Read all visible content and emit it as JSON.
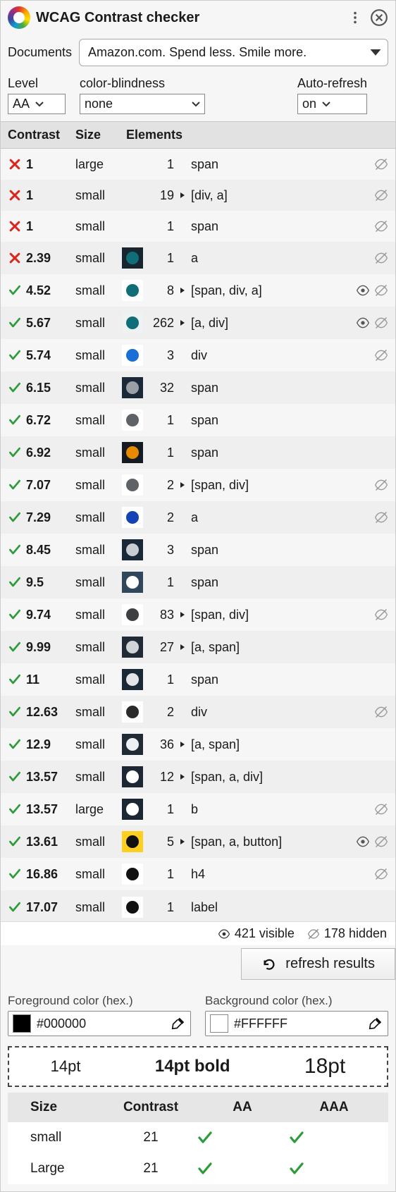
{
  "header": {
    "title": "WCAG Contrast checker"
  },
  "documents": {
    "label": "Documents",
    "selected": "Amazon.com. Spend less. Smile more."
  },
  "level": {
    "label": "Level",
    "value": "AA"
  },
  "cb": {
    "label": "color-blindness",
    "value": "none"
  },
  "autorefresh": {
    "label": "Auto-refresh",
    "value": "on"
  },
  "table": {
    "headers": {
      "contrast": "Contrast",
      "size": "Size",
      "elements": "Elements"
    },
    "rows": [
      {
        "pass": false,
        "contrast": "1",
        "size": "large",
        "swatch_bg": null,
        "swatch_fg": null,
        "count": 1,
        "expandable": false,
        "elements": "span",
        "eye": false,
        "hide": true
      },
      {
        "pass": false,
        "contrast": "1",
        "size": "small",
        "swatch_bg": null,
        "swatch_fg": null,
        "count": 19,
        "expandable": true,
        "elements": "[div, a]",
        "eye": false,
        "hide": true
      },
      {
        "pass": false,
        "contrast": "1",
        "size": "small",
        "swatch_bg": null,
        "swatch_fg": null,
        "count": 1,
        "expandable": false,
        "elements": "span",
        "eye": false,
        "hide": true
      },
      {
        "pass": false,
        "contrast": "2.39",
        "size": "small",
        "swatch_bg": "#16252f",
        "swatch_fg": "#0f6e78",
        "count": 1,
        "expandable": false,
        "elements": "a",
        "eye": false,
        "hide": true
      },
      {
        "pass": true,
        "contrast": "4.52",
        "size": "small",
        "swatch_bg": "#ffffff",
        "swatch_fg": "#0f6e78",
        "count": 8,
        "expandable": true,
        "elements": "[span, div, a]",
        "eye": true,
        "hide": true
      },
      {
        "pass": true,
        "contrast": "5.67",
        "size": "small",
        "swatch_bg": "#eef2f2",
        "swatch_fg": "#0f6e78",
        "count": 262,
        "expandable": true,
        "elements": "[a, div]",
        "eye": true,
        "hide": true
      },
      {
        "pass": true,
        "contrast": "5.74",
        "size": "small",
        "swatch_bg": "#ffffff",
        "swatch_fg": "#1a6fd6",
        "count": 3,
        "expandable": false,
        "elements": "div",
        "eye": false,
        "hide": true
      },
      {
        "pass": true,
        "contrast": "6.15",
        "size": "small",
        "swatch_bg": "#1b2838",
        "swatch_fg": "#9aa0a6",
        "count": 32,
        "expandable": false,
        "elements": "span",
        "eye": false,
        "hide": false
      },
      {
        "pass": true,
        "contrast": "6.72",
        "size": "small",
        "swatch_bg": "#ffffff",
        "swatch_fg": "#5f6368",
        "count": 1,
        "expandable": false,
        "elements": "span",
        "eye": false,
        "hide": false
      },
      {
        "pass": true,
        "contrast": "6.92",
        "size": "small",
        "swatch_bg": "#131a22",
        "swatch_fg": "#e68a00",
        "count": 1,
        "expandable": false,
        "elements": "span",
        "eye": false,
        "hide": false
      },
      {
        "pass": true,
        "contrast": "7.07",
        "size": "small",
        "swatch_bg": "#ffffff",
        "swatch_fg": "#5f6368",
        "count": 2,
        "expandable": true,
        "elements": "[span, div]",
        "eye": false,
        "hide": true
      },
      {
        "pass": true,
        "contrast": "7.29",
        "size": "small",
        "swatch_bg": "#ffffff",
        "swatch_fg": "#1444b3",
        "count": 2,
        "expandable": false,
        "elements": "a",
        "eye": false,
        "hide": true
      },
      {
        "pass": true,
        "contrast": "8.45",
        "size": "small",
        "swatch_bg": "#1b2838",
        "swatch_fg": "#c8cdd2",
        "count": 3,
        "expandable": false,
        "elements": "span",
        "eye": false,
        "hide": false
      },
      {
        "pass": true,
        "contrast": "9.5",
        "size": "small",
        "swatch_bg": "#30465a",
        "swatch_fg": "#ffffff",
        "count": 1,
        "expandable": false,
        "elements": "span",
        "eye": false,
        "hide": false
      },
      {
        "pass": true,
        "contrast": "9.74",
        "size": "small",
        "swatch_bg": "#ffffff",
        "swatch_fg": "#3e3f41",
        "count": 83,
        "expandable": true,
        "elements": "[span, div]",
        "eye": false,
        "hide": true
      },
      {
        "pass": true,
        "contrast": "9.99",
        "size": "small",
        "swatch_bg": "#212b36",
        "swatch_fg": "#d0d4d8",
        "count": 27,
        "expandable": true,
        "elements": "[a, span]",
        "eye": false,
        "hide": false
      },
      {
        "pass": true,
        "contrast": "11",
        "size": "small",
        "swatch_bg": "#1b2838",
        "swatch_fg": "#e2e5e8",
        "count": 1,
        "expandable": false,
        "elements": "span",
        "eye": false,
        "hide": false
      },
      {
        "pass": true,
        "contrast": "12.63",
        "size": "small",
        "swatch_bg": "#ffffff",
        "swatch_fg": "#2a2a2a",
        "count": 2,
        "expandable": false,
        "elements": "div",
        "eye": false,
        "hide": true
      },
      {
        "pass": true,
        "contrast": "12.9",
        "size": "small",
        "swatch_bg": "#212b36",
        "swatch_fg": "#eef1f3",
        "count": 36,
        "expandable": true,
        "elements": "[a, span]",
        "eye": false,
        "hide": false
      },
      {
        "pass": true,
        "contrast": "13.57",
        "size": "small",
        "swatch_bg": "#1c2733",
        "swatch_fg": "#ffffff",
        "count": 12,
        "expandable": true,
        "elements": "[span, a, div]",
        "eye": false,
        "hide": false
      },
      {
        "pass": true,
        "contrast": "13.57",
        "size": "large",
        "swatch_bg": "#1c2733",
        "swatch_fg": "#ffffff",
        "count": 1,
        "expandable": false,
        "elements": "b",
        "eye": false,
        "hide": true
      },
      {
        "pass": true,
        "contrast": "13.61",
        "size": "small",
        "swatch_bg": "#ffcf20",
        "swatch_fg": "#111111",
        "count": 5,
        "expandable": true,
        "elements": "[span, a, button]",
        "eye": true,
        "hide": true
      },
      {
        "pass": true,
        "contrast": "16.86",
        "size": "small",
        "swatch_bg": "#ffffff",
        "swatch_fg": "#111111",
        "count": 1,
        "expandable": false,
        "elements": "h4",
        "eye": false,
        "hide": true
      },
      {
        "pass": true,
        "contrast": "17.07",
        "size": "small",
        "swatch_bg": "#ffffff",
        "swatch_fg": "#111111",
        "count": 1,
        "expandable": false,
        "elements": "label",
        "eye": false,
        "hide": false,
        "cut": true
      }
    ]
  },
  "status": {
    "visible": "421 visible",
    "hidden": "178 hidden"
  },
  "refresh": {
    "label": "refresh results"
  },
  "colors": {
    "fg_label": "Foreground color (hex.)",
    "bg_label": "Background color (hex.)",
    "fg_value": "#000000",
    "bg_value": "#FFFFFF"
  },
  "preview": {
    "p14": "14pt",
    "p14b": "14pt bold",
    "p18": "18pt"
  },
  "summary": {
    "headers": {
      "size": "Size",
      "contrast": "Contrast",
      "aa": "AA",
      "aaa": "AAA"
    },
    "rows": [
      {
        "size": "small",
        "contrast": "21",
        "aa": true,
        "aaa": true
      },
      {
        "size": "Large",
        "contrast": "21",
        "aa": true,
        "aaa": true
      }
    ]
  }
}
